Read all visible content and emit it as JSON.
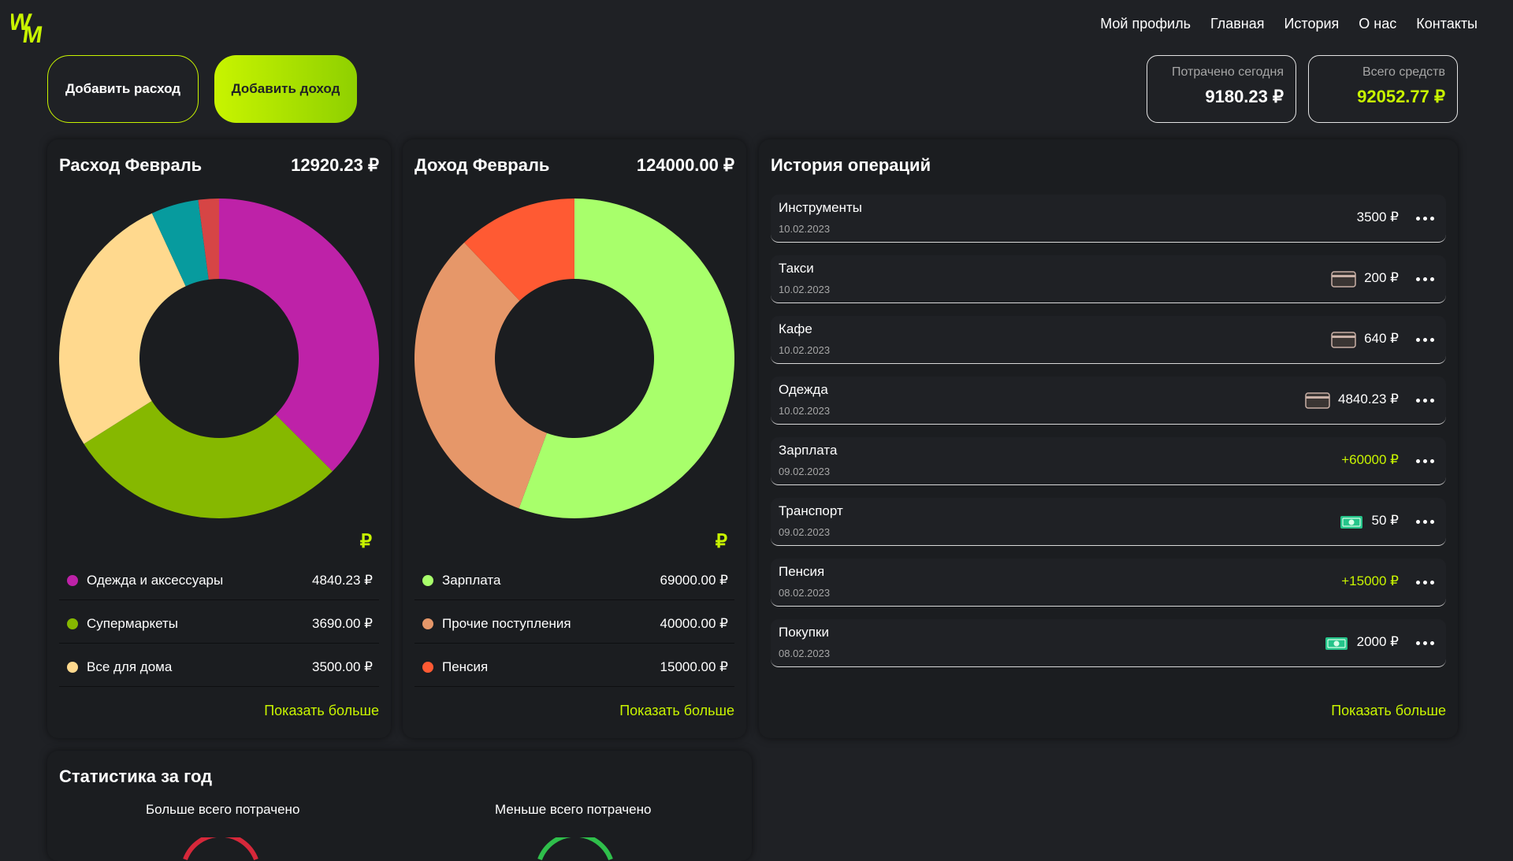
{
  "logo": {
    "text": "WM",
    "color": "#c8f400"
  },
  "nav": [
    "Мой профиль",
    "Главная",
    "История",
    "О нас",
    "Контакты"
  ],
  "actions": {
    "add_expense": "Добавить расход",
    "add_income": "Добавить доход"
  },
  "stats": {
    "spent_today_label": "Потрачено сегодня",
    "spent_today_value": "9180.23 ₽",
    "total_label": "Всего средств",
    "total_value": "92052.77 ₽"
  },
  "expense": {
    "title": "Расход Февраль",
    "total": "12920.23 ₽",
    "currency_symbol": "₽",
    "legend": [
      {
        "name": "Одежда и аксессуары",
        "amount": "4840.23 ₽",
        "color": "#be22a8"
      },
      {
        "name": "Супермаркеты",
        "amount": "3690.00 ₽",
        "color": "#86b800"
      },
      {
        "name": "Все для дома",
        "amount": "3500.00 ₽",
        "color": "#ffd98e"
      }
    ],
    "more": "Показать больше"
  },
  "income": {
    "title": "Доход Февраль",
    "total": "124000.00 ₽",
    "currency_symbol": "₽",
    "legend": [
      {
        "name": "Зарплата",
        "amount": "69000.00 ₽",
        "color": "#a8ff6b"
      },
      {
        "name": "Прочие поступления",
        "amount": "40000.00 ₽",
        "color": "#e69769"
      },
      {
        "name": "Пенсия",
        "amount": "15000.00 ₽",
        "color": "#ff5a33"
      }
    ],
    "more": "Показать больше"
  },
  "chart_data": [
    {
      "type": "pie",
      "title": "Расход Февраль",
      "categories": [
        "Одежда и аксессуары",
        "Супермаркеты",
        "Все для дома",
        "",
        ""
      ],
      "values": [
        4840.23,
        3690.0,
        3500.0,
        620,
        270
      ],
      "colors": [
        "#be22a8",
        "#86b800",
        "#ffd98e",
        "#079b9e",
        "#d64545"
      ]
    },
    {
      "type": "pie",
      "title": "Доход Февраль",
      "categories": [
        "Зарплата",
        "Прочие поступления",
        "Пенсия"
      ],
      "values": [
        69000,
        40000,
        15000
      ],
      "colors": [
        "#a8ff6b",
        "#e69769",
        "#ff5a33"
      ]
    }
  ],
  "history": {
    "title": "История операций",
    "items": [
      {
        "name": "Инструменты",
        "date": "10.02.2023",
        "amount": "3500 ₽",
        "type": "expense",
        "payment": ""
      },
      {
        "name": "Такси",
        "date": "10.02.2023",
        "amount": "200 ₽",
        "type": "expense",
        "payment": "card"
      },
      {
        "name": "Кафе",
        "date": "10.02.2023",
        "amount": "640 ₽",
        "type": "expense",
        "payment": "card"
      },
      {
        "name": "Одежда",
        "date": "10.02.2023",
        "amount": "4840.23 ₽",
        "type": "expense",
        "payment": "card"
      },
      {
        "name": "Зарплата",
        "date": "09.02.2023",
        "amount": "+60000 ₽",
        "type": "income",
        "payment": ""
      },
      {
        "name": "Транспорт",
        "date": "09.02.2023",
        "amount": "50 ₽",
        "type": "expense",
        "payment": "cash"
      },
      {
        "name": "Пенсия",
        "date": "08.02.2023",
        "amount": "+15000 ₽",
        "type": "income",
        "payment": ""
      },
      {
        "name": "Покупки",
        "date": "08.02.2023",
        "amount": "2000 ₽",
        "type": "expense",
        "payment": "cash"
      }
    ],
    "more": "Показать больше"
  },
  "year_stats": {
    "title": "Статистика за год",
    "most_spent": "Больше всего потрачено",
    "least_spent": "Меньше всего потрачено"
  }
}
